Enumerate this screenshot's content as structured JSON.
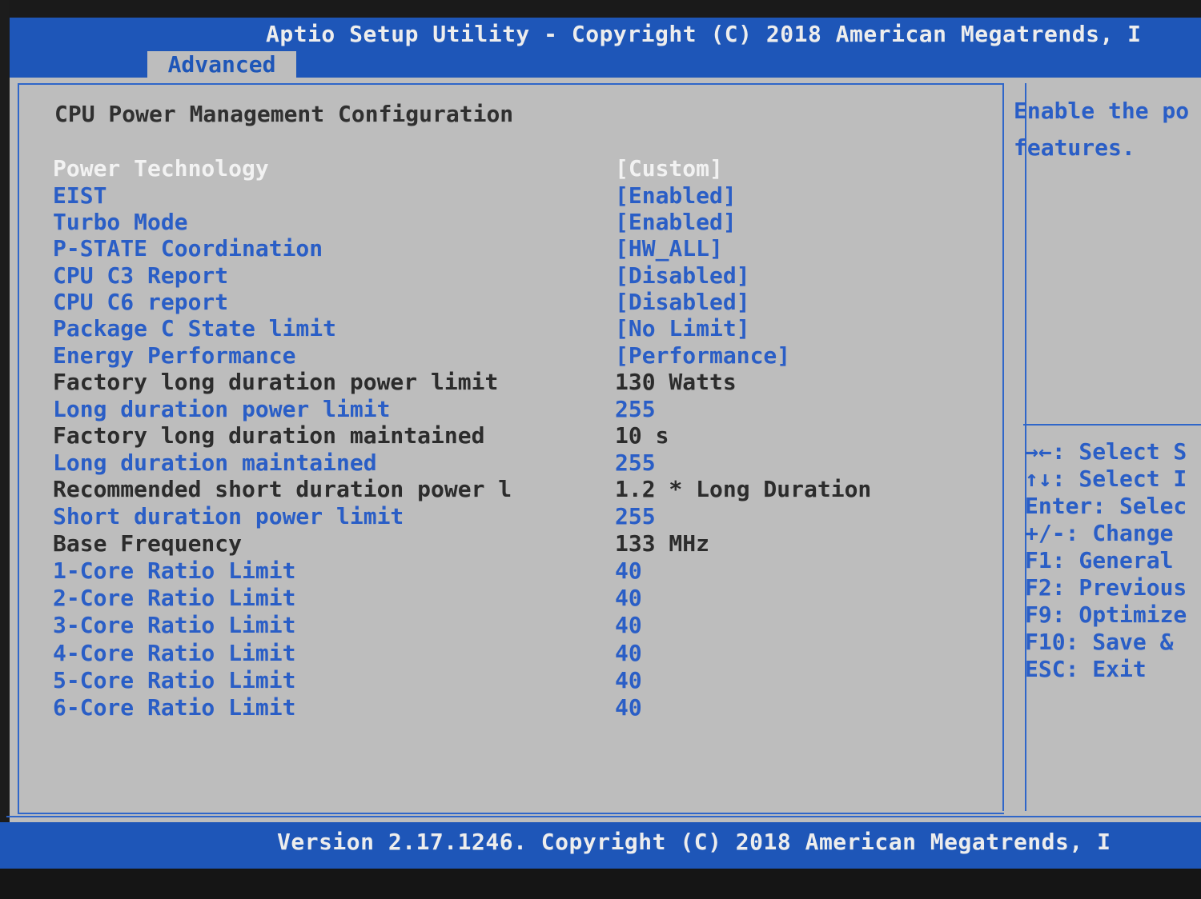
{
  "header": {
    "title": "Aptio Setup Utility - Copyright (C) 2018 American Megatrends, I",
    "active_tab": "Advanced"
  },
  "page": {
    "section_title": "CPU Power Management Configuration"
  },
  "settings": [
    {
      "label": "Power Technology",
      "value": "[Custom]"
    },
    {
      "label": "EIST",
      "value": "[Enabled]"
    },
    {
      "label": "Turbo Mode",
      "value": "[Enabled]"
    },
    {
      "label": "P-STATE Coordination",
      "value": "[HW_ALL]"
    },
    {
      "label": "CPU C3 Report",
      "value": "[Disabled]"
    },
    {
      "label": "CPU C6 report",
      "value": "[Disabled]"
    },
    {
      "label": "Package C State limit",
      "value": "[No Limit]"
    },
    {
      "label": "Energy Performance",
      "value": "[Performance]"
    },
    {
      "label": "Factory long duration power limit",
      "value": "130 Watts"
    },
    {
      "label": "Long duration power limit",
      "value": "255"
    },
    {
      "label": "Factory long duration maintained",
      "value": "10 s"
    },
    {
      "label": "Long duration maintained",
      "value": "255"
    },
    {
      "label": "Recommended short duration power l",
      "value": "1.2 * Long Duration"
    },
    {
      "label": "Short duration power limit",
      "value": "255"
    },
    {
      "label": "Base Frequency",
      "value": "133 MHz"
    },
    {
      "label": "1-Core Ratio Limit",
      "value": "40"
    },
    {
      "label": "2-Core Ratio Limit",
      "value": "40"
    },
    {
      "label": "3-Core Ratio Limit",
      "value": "40"
    },
    {
      "label": "4-Core Ratio Limit",
      "value": "40"
    },
    {
      "label": "5-Core Ratio Limit",
      "value": "40"
    },
    {
      "label": "6-Core Ratio Limit",
      "value": "40"
    }
  ],
  "help": {
    "line1": "Enable the po",
    "line2": "features."
  },
  "keys": [
    "→←: Select S",
    "↑↓: Select I",
    "Enter: Selec",
    "+/-: Change",
    "F1: General",
    "F2: Previous",
    "F9: Optimize",
    "F10: Save &",
    "ESC: Exit"
  ],
  "footer": {
    "text": "Version 2.17.1246. Copyright (C) 2018 American Megatrends, I"
  },
  "colors": {
    "bar_blue": "#1e56b8",
    "panel_gray": "#bdbdbd",
    "selectable_blue": "#2a5ec6",
    "highlight_white": "#f2f2f2",
    "static_dark": "#2c2c2c"
  }
}
